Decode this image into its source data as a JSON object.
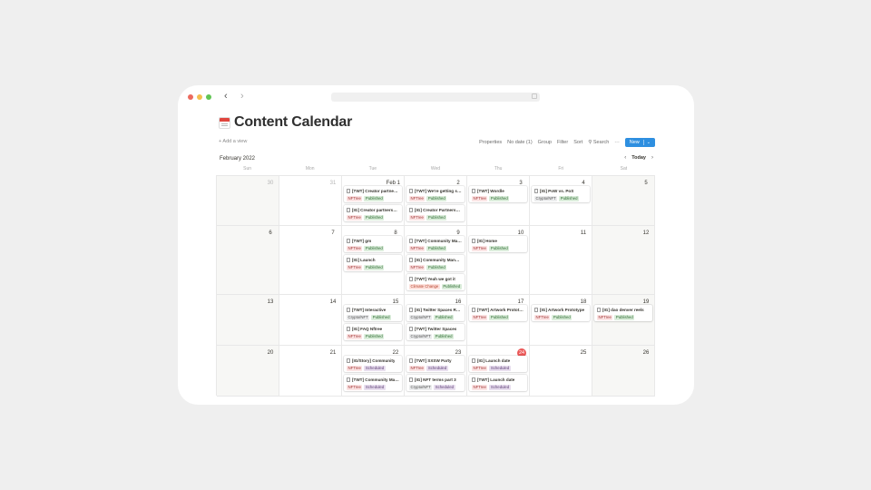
{
  "page": {
    "title": "Content Calendar",
    "add_view": "+ Add a view",
    "month": "February 2022",
    "today": "Today"
  },
  "toolbar": {
    "properties": "Properties",
    "no_date": "No date (1)",
    "group": "Group",
    "filter": "Filter",
    "sort": "Sort",
    "search": "Search",
    "more": "···",
    "new": "New",
    "new_caret": "⌄"
  },
  "weekdays": [
    "Sun",
    "Mon",
    "Tue",
    "Wed",
    "Thu",
    "Fri",
    "Sat"
  ],
  "colors": {
    "accent": "#2e8fe0",
    "today_marker": "#eb5757",
    "published": "#dbeddb",
    "scheduled": "#e8deee",
    "nftree": "#fbe4e4"
  },
  "weeks": [
    [
      {
        "num": "30",
        "muted": true,
        "cards": []
      },
      {
        "num": "31",
        "muted": true,
        "cards": []
      },
      {
        "num": "Feb 1",
        "cards": [
          {
            "title": "[TWT] Creator partnership",
            "tags": [
              "NFTree",
              "Published"
            ]
          },
          {
            "title": "[IG] Creator partnership",
            "tags": [
              "NFTree",
              "Published"
            ]
          }
        ]
      },
      {
        "num": "2",
        "cards": [
          {
            "title": "[TWT] We're getting started",
            "tags": [
              "NFTree",
              "Published"
            ]
          },
          {
            "title": "[IG] Creator Partnership",
            "tags": [
              "NFTree",
              "Published"
            ]
          }
        ]
      },
      {
        "num": "3",
        "cards": [
          {
            "title": "[TWT] Wordle",
            "tags": [
              "NFTree",
              "Published"
            ]
          }
        ]
      },
      {
        "num": "4",
        "cards": [
          {
            "title": "[IG] PoW vs. PoS",
            "tags": [
              "Crypto/NFT",
              "Published"
            ]
          }
        ]
      },
      {
        "num": "5",
        "cards": []
      }
    ],
    [
      {
        "num": "6",
        "cards": []
      },
      {
        "num": "7",
        "cards": []
      },
      {
        "num": "8",
        "cards": [
          {
            "title": "[TWT] gm",
            "tags": [
              "NFTree",
              "Published"
            ]
          },
          {
            "title": "[IG] Launch",
            "tags": [
              "NFTree",
              "Published"
            ]
          }
        ]
      },
      {
        "num": "9",
        "cards": [
          {
            "title": "[TWT] Community Management",
            "tags": [
              "NFTree",
              "Published"
            ]
          },
          {
            "title": "[IG] Community Management",
            "tags": [
              "NFTree",
              "Published"
            ]
          },
          {
            "title": "[TWT] Yeah we got it",
            "tags": [
              "Climate Change",
              "Published"
            ]
          }
        ]
      },
      {
        "num": "10",
        "cards": [
          {
            "title": "[IG] Home",
            "tags": [
              "NFTree",
              "Published"
            ]
          }
        ]
      },
      {
        "num": "11",
        "cards": []
      },
      {
        "num": "12",
        "cards": []
      }
    ],
    [
      {
        "num": "13",
        "cards": []
      },
      {
        "num": "14",
        "cards": []
      },
      {
        "num": "15",
        "cards": [
          {
            "title": "[TWT] Interactive",
            "tags": [
              "Crypto/NFT",
              "Published"
            ]
          },
          {
            "title": "[IG] FAQ Nftree",
            "tags": [
              "NFTree",
              "Published"
            ]
          }
        ]
      },
      {
        "num": "16",
        "cards": [
          {
            "title": "[IG] Twitter Spaces Recap",
            "tags": [
              "Crypto/NFT",
              "Published"
            ]
          },
          {
            "title": "[TWT] Twitter Spaces",
            "tags": [
              "Crypto/NFT",
              "Published"
            ]
          }
        ]
      },
      {
        "num": "17",
        "cards": [
          {
            "title": "[TWT] Artwork Prototype",
            "tags": [
              "NFTree",
              "Published"
            ]
          }
        ]
      },
      {
        "num": "18",
        "cards": [
          {
            "title": "[IG] Artwork Prototype",
            "tags": [
              "NFTree",
              "Published"
            ]
          }
        ]
      },
      {
        "num": "19",
        "cards": [
          {
            "title": "[IG] dao denver reels",
            "tags": [
              "NFTree",
              "Published"
            ]
          }
        ]
      }
    ],
    [
      {
        "num": "20",
        "cards": []
      },
      {
        "num": "21",
        "cards": []
      },
      {
        "num": "22",
        "cards": [
          {
            "title": "[IG/Story] Community",
            "tags": [
              "NFTree",
              "Scheduled"
            ]
          },
          {
            "title": "[TWT] Community Management",
            "tags": [
              "NFTree",
              "Scheduled"
            ]
          }
        ]
      },
      {
        "num": "23",
        "cards": [
          {
            "title": "[TWT] SXSW Party",
            "tags": [
              "NFTree",
              "Scheduled"
            ]
          },
          {
            "title": "[IG] NFT terms part 3",
            "tags": [
              "Crypto/NFT",
              "Scheduled"
            ]
          }
        ]
      },
      {
        "num": "24",
        "today": true,
        "cards": [
          {
            "title": "[IG] Launch date",
            "tags": [
              "NFTree",
              "Scheduled"
            ]
          },
          {
            "title": "[TWT] Launch date",
            "tags": [
              "NFTree",
              "Scheduled"
            ]
          }
        ]
      },
      {
        "num": "25",
        "cards": []
      },
      {
        "num": "26",
        "cards": []
      }
    ]
  ]
}
